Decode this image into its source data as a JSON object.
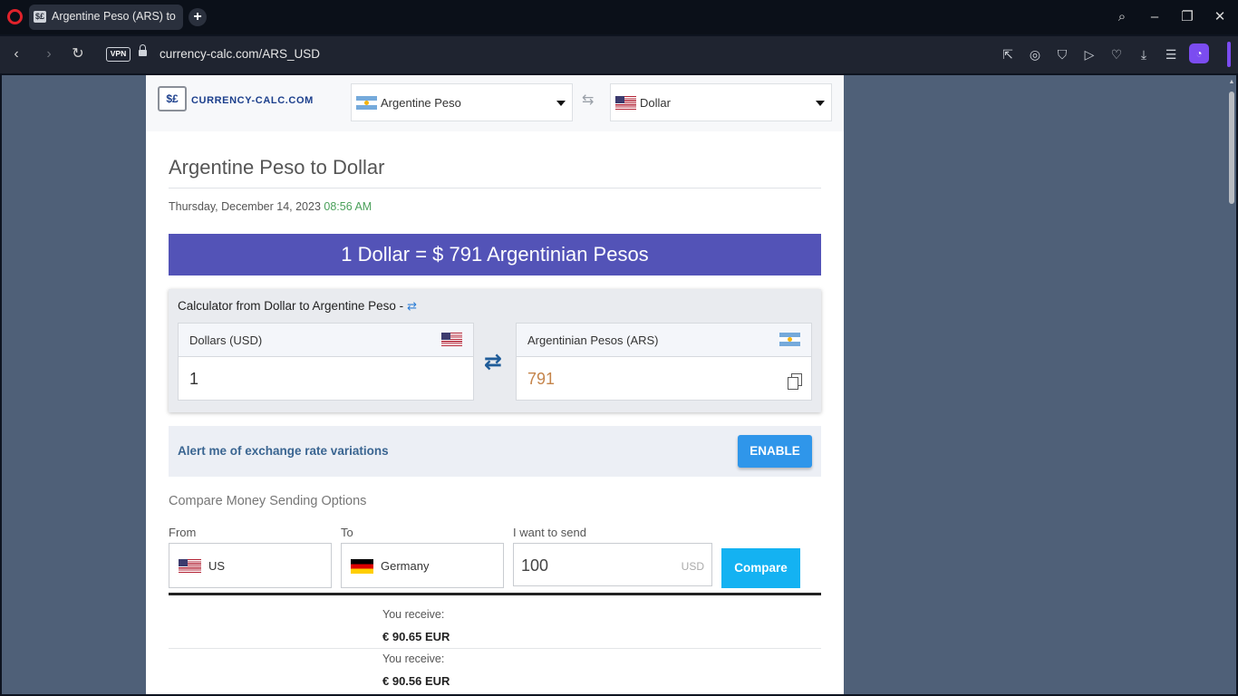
{
  "browser": {
    "tab_title": "Argentine Peso (ARS) to Euro",
    "favicon": "currency-favicon",
    "url": "currency-calc.com/ARS_USD",
    "vpn_label": "VPN"
  },
  "site": {
    "logo_text": "CURRENCY-CALC.COM",
    "logo_glyph": "$£",
    "from_currency": "Argentine Peso",
    "to_currency": "Dollar"
  },
  "main": {
    "title": "Argentine Peso to Dollar",
    "date": "Thursday, December 14, 2023",
    "time": "08:56 AM",
    "rate_banner": "1 Dollar = $ 791 Argentinian Pesos"
  },
  "calculator": {
    "title": "Calculator from Dollar to Argentine Peso -",
    "input_label": "Dollars (USD)",
    "input_value": "1",
    "output_label": "Argentinian Pesos (ARS)",
    "output_value": "791"
  },
  "alert": {
    "text": "Alert me of exchange rate variations",
    "button": "ENABLE"
  },
  "compare": {
    "title": "Compare Money Sending Options",
    "from_label": "From",
    "from_value": "US",
    "to_label": "To",
    "to_value": "Germany",
    "send_label": "I want to send",
    "send_amount": "100",
    "send_unit": "USD",
    "button": "Compare"
  },
  "results": [
    {
      "label": "You receive:",
      "value": "€ 90.65 EUR"
    },
    {
      "label": "You receive:",
      "value": "€ 90.56 EUR"
    }
  ],
  "colors": {
    "banner": "#5353b7",
    "enable_button": "#2f96ea",
    "compare_button": "#14b2f2",
    "time_green": "#4aa05a",
    "output_orange": "#c5844a"
  }
}
